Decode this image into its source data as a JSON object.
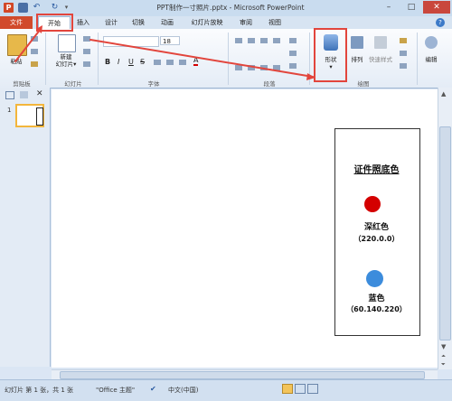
{
  "window": {
    "title": "PPT制作一寸照片.pptx - Microsoft PowerPoint"
  },
  "tabs": [
    {
      "label": "文件"
    },
    {
      "label": "开始"
    },
    {
      "label": "插入"
    },
    {
      "label": "设计"
    },
    {
      "label": "切换"
    },
    {
      "label": "动画"
    },
    {
      "label": "幻灯片放映"
    },
    {
      "label": "审阅"
    },
    {
      "label": "视图"
    }
  ],
  "ribbon": {
    "clipboard": {
      "paste_label": "粘贴",
      "group_label": "剪贴板"
    },
    "slides": {
      "new_slide_label": "新建\n幻灯片",
      "group_label": "幻灯片"
    },
    "font": {
      "font_size": "18",
      "group_label": "字体"
    },
    "paragraph": {
      "group_label": "段落"
    },
    "drawing": {
      "shapes_label": "形状",
      "arrange_label": "排列",
      "quick_styles_label": "快速样式",
      "group_label": "绘图"
    },
    "editing": {
      "label": "编辑"
    }
  },
  "slide_panel": {
    "slide_number": "1"
  },
  "slide": {
    "card_title": "证件照底色",
    "color1": {
      "name": "深红色",
      "rgb": "（220.0.0）",
      "swatch": "#d40000"
    },
    "color2": {
      "name": "蓝色",
      "rgb": "（60.140.220）",
      "swatch": "#3c8cdc"
    }
  },
  "status": {
    "slide_info": "幻灯片 第 1 张，共 1 张",
    "theme": "\"Office 主题\"",
    "language": "中文(中国)"
  },
  "colors": {
    "annotation_red": "#e2453c",
    "file_tab": "#d14a2b"
  }
}
